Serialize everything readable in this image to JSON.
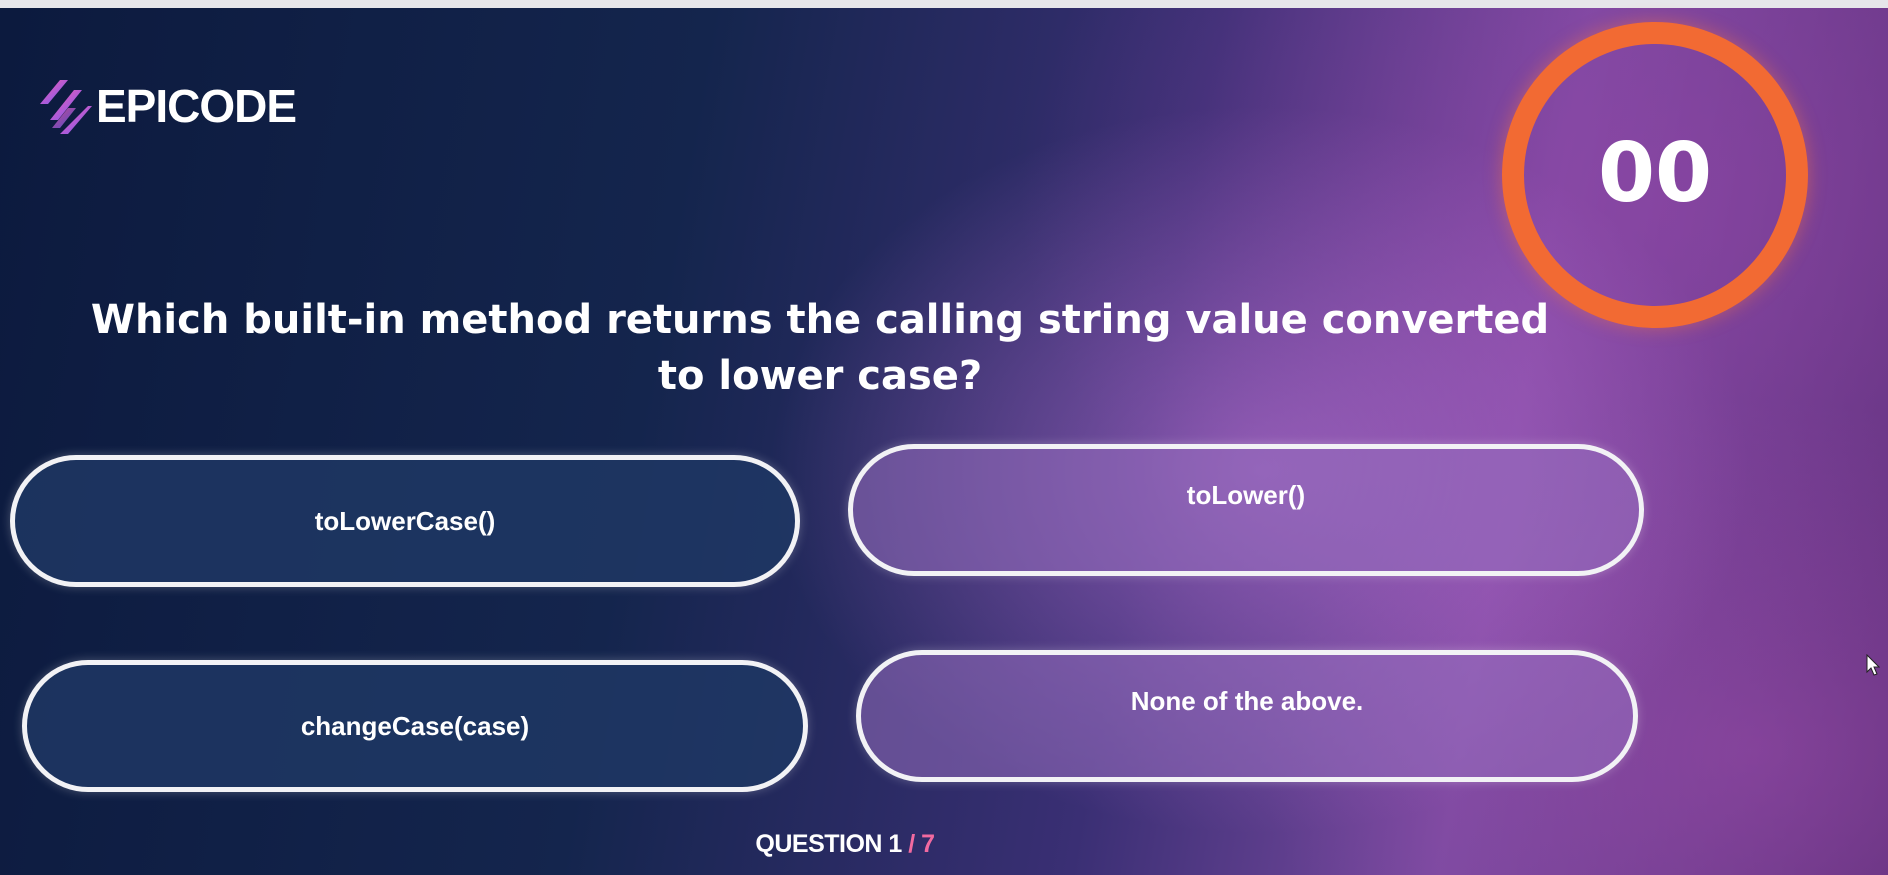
{
  "app": {
    "logo_text": "EPICODE"
  },
  "timer": {
    "value": "00",
    "color": "#f26a33"
  },
  "question": {
    "text": "Which built-in method returns the calling string value converted to lower case?"
  },
  "answers": [
    {
      "label": "toLowerCase()"
    },
    {
      "label": "toLower()"
    },
    {
      "label": "changeCase(case)"
    },
    {
      "label": "None of the above."
    }
  ],
  "footer": {
    "prefix": "QUESTION 1",
    "separator": " / ",
    "total": "7"
  },
  "icons": {
    "logo": "epicode-logo-icon",
    "cursor": "mouse-cursor-icon"
  }
}
